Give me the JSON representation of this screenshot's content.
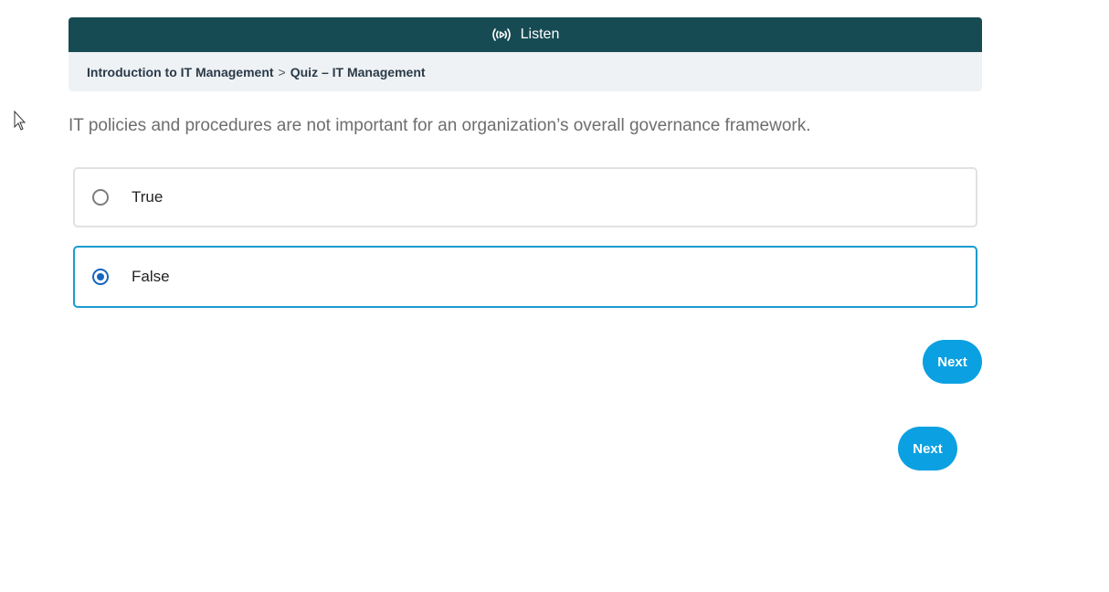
{
  "listen_bar": {
    "label": "Listen",
    "icon": "broadcast-icon"
  },
  "breadcrumb": {
    "items": [
      "Introduction to IT Management",
      "Quiz – IT Management"
    ],
    "separator": ">"
  },
  "question": {
    "text": "IT policies and procedures are not important for an organization’s overall governance framework."
  },
  "options": [
    {
      "label": "True",
      "selected": false
    },
    {
      "label": "False",
      "selected": true
    }
  ],
  "buttons": {
    "next_primary": "Next",
    "next_secondary": "Next"
  },
  "colors": {
    "listen_bar_bg": "#174b53",
    "breadcrumb_bg": "#eef2f5",
    "selected_border": "#1a9bd0",
    "radio_checked": "#1565c0",
    "next_button_bg": "#0ba0e2"
  }
}
